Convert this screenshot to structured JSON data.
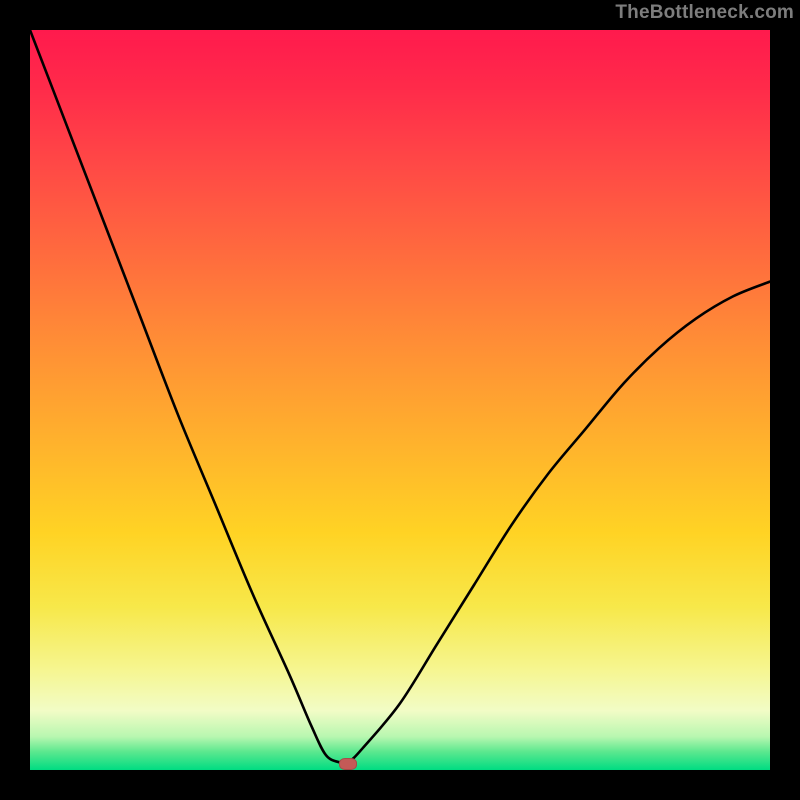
{
  "watermark": "TheBottleneck.com",
  "chart_data": {
    "type": "line",
    "title": "",
    "xlabel": "",
    "ylabel": "",
    "xlim": [
      0,
      100
    ],
    "ylim": [
      0,
      100
    ],
    "grid": false,
    "legend": false,
    "series": [
      {
        "name": "bottleneck-curve",
        "x": [
          0,
          5,
          10,
          15,
          20,
          25,
          30,
          35,
          38,
          40,
          42,
          43,
          45,
          50,
          55,
          60,
          65,
          70,
          75,
          80,
          85,
          90,
          95,
          100
        ],
        "values": [
          100,
          87,
          74,
          61,
          48,
          36,
          24,
          13,
          6,
          2,
          1,
          1,
          3,
          9,
          17,
          25,
          33,
          40,
          46,
          52,
          57,
          61,
          64,
          66
        ]
      }
    ],
    "annotations": [
      {
        "name": "optimal-marker",
        "x": 43,
        "y": 0.8
      }
    ],
    "background_gradient_stops": [
      {
        "pos": 0,
        "color": "#ff1a4d"
      },
      {
        "pos": 0.5,
        "color": "#ffb02d"
      },
      {
        "pos": 0.9,
        "color": "#f6f58c"
      },
      {
        "pos": 1.0,
        "color": "#00dc82"
      }
    ]
  }
}
